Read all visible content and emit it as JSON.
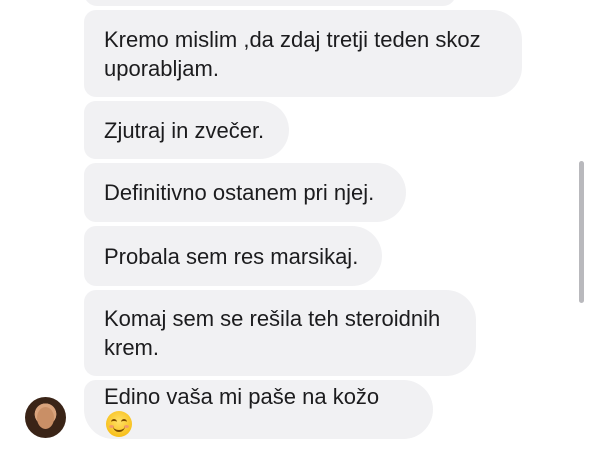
{
  "messages": [
    {
      "text": ""
    },
    {
      "text": "Kremo mislim ,da zdaj tretji teden skoz uporabljam."
    },
    {
      "text": "Zjutraj in zvečer."
    },
    {
      "text": "Definitivno ostanem pri njej."
    },
    {
      "text": "Probala sem res marsikaj."
    },
    {
      "text": "Komaj sem se rešila teh steroidnih krem."
    },
    {
      "text": "Edino vaša mi paše na kožo",
      "emoji": "smiling-face-with-smiling-eyes"
    }
  ],
  "colors": {
    "bubble": "#f1f1f3",
    "text": "#1c1c1e",
    "scrollbar": "#b9b9bd"
  }
}
